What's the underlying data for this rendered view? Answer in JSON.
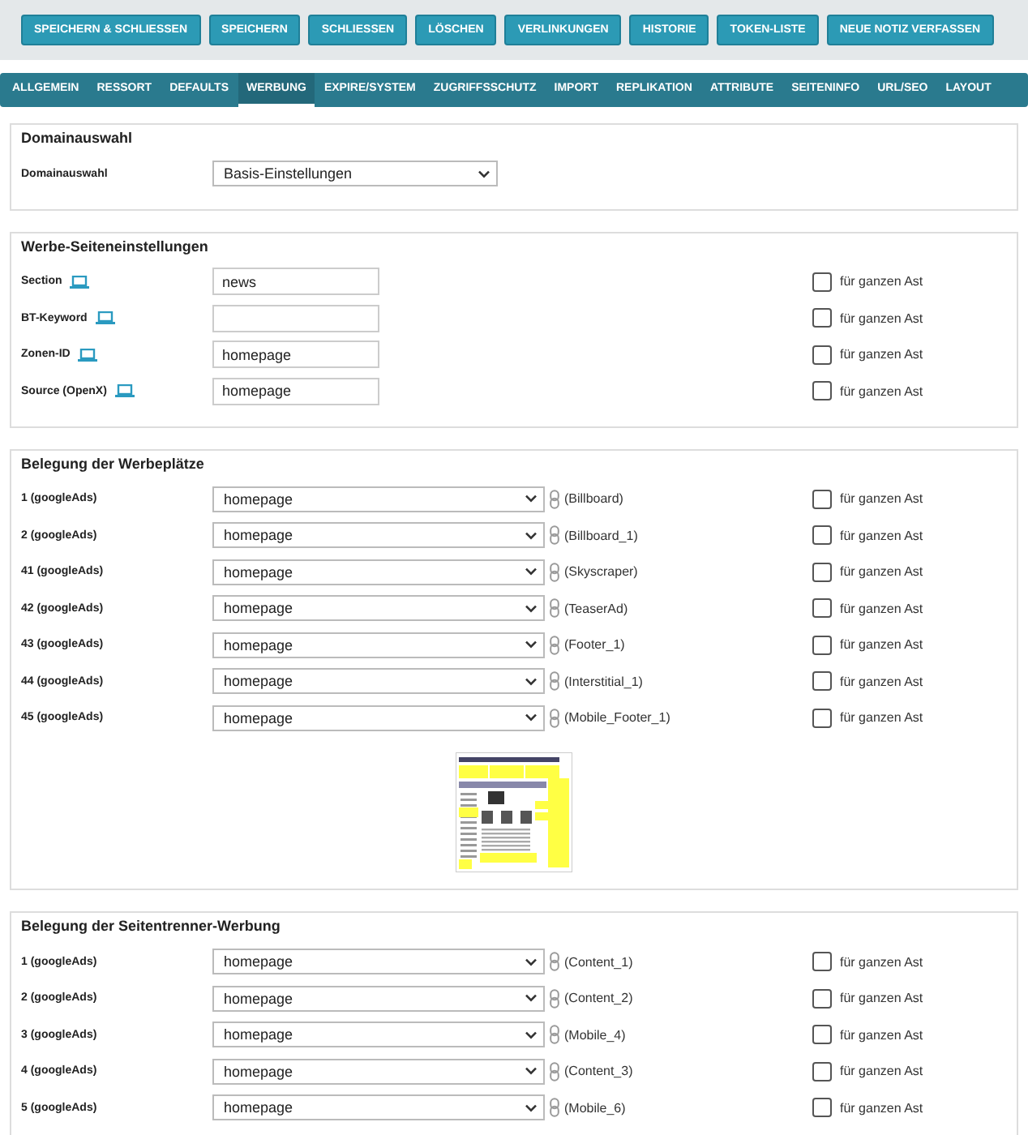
{
  "toolbar": {
    "buttons": [
      "SPEICHERN & SCHLIESSEN",
      "SPEICHERN",
      "SCHLIESSEN",
      "LÖSCHEN",
      "VERLINKUNGEN",
      "HISTORIE",
      "TOKEN-LISTE",
      "NEUE NOTIZ VERFASSEN"
    ]
  },
  "tabs": [
    {
      "label": "ALLGEMEIN",
      "selected": false
    },
    {
      "label": "RESSORT",
      "selected": false
    },
    {
      "label": "DEFAULTS",
      "selected": false
    },
    {
      "label": "WERBUNG",
      "selected": true
    },
    {
      "label": "EXPIRE/SYSTEM",
      "selected": false
    },
    {
      "label": "ZUGRIFFSSCHUTZ",
      "selected": false
    },
    {
      "label": "IMPORT",
      "selected": false
    },
    {
      "label": "REPLIKATION",
      "selected": false
    },
    {
      "label": "ATTRIBUTE",
      "selected": false
    },
    {
      "label": "SEITENINFO",
      "selected": false
    },
    {
      "label": "URL/SEO",
      "selected": false
    },
    {
      "label": "LAYOUT",
      "selected": false
    }
  ],
  "domain": {
    "legend": "Domainauswahl",
    "label": "Domainauswahl",
    "value": "Basis-Einstellungen"
  },
  "page_settings": {
    "legend": "Werbe-Seiteneinstellungen",
    "rows": [
      {
        "label": "Section",
        "value": "news",
        "branch_label": "für ganzen Ast",
        "checked": false
      },
      {
        "label": "BT-Keyword",
        "value": "",
        "branch_label": "für ganzen Ast",
        "checked": false
      },
      {
        "label": "Zonen-ID",
        "value": "homepage",
        "branch_label": "für ganzen Ast",
        "checked": false
      },
      {
        "label": "Source (OpenX)",
        "value": "homepage",
        "branch_label": "für ganzen Ast",
        "checked": false
      }
    ]
  },
  "placements": {
    "legend": "Belegung der Werbeplätze",
    "rows": [
      {
        "label": "1 (googleAds)",
        "value": "homepage",
        "slot": "(Billboard)",
        "branch_label": "für ganzen Ast",
        "checked": false
      },
      {
        "label": "2 (googleAds)",
        "value": "homepage",
        "slot": "(Billboard_1)",
        "branch_label": "für ganzen Ast",
        "checked": false
      },
      {
        "label": "41 (googleAds)",
        "value": "homepage",
        "slot": "(Skyscraper)",
        "branch_label": "für ganzen Ast",
        "checked": false
      },
      {
        "label": "42 (googleAds)",
        "value": "homepage",
        "slot": "(TeaserAd)",
        "branch_label": "für ganzen Ast",
        "checked": false
      },
      {
        "label": "43 (googleAds)",
        "value": "homepage",
        "slot": "(Footer_1)",
        "branch_label": "für ganzen Ast",
        "checked": false
      },
      {
        "label": "44 (googleAds)",
        "value": "homepage",
        "slot": "(Interstitial_1)",
        "branch_label": "für ganzen Ast",
        "checked": false
      },
      {
        "label": "45 (googleAds)",
        "value": "homepage",
        "slot": "(Mobile_Footer_1)",
        "branch_label": "für ganzen Ast",
        "checked": false
      }
    ]
  },
  "separators": {
    "legend": "Belegung der Seitentrenner-Werbung",
    "rows": [
      {
        "label": "1 (googleAds)",
        "value": "homepage",
        "slot": "(Content_1)",
        "branch_label": "für ganzen Ast",
        "checked": false
      },
      {
        "label": "2 (googleAds)",
        "value": "homepage",
        "slot": "(Content_2)",
        "branch_label": "für ganzen Ast",
        "checked": false
      },
      {
        "label": "3 (googleAds)",
        "value": "homepage",
        "slot": "(Mobile_4)",
        "branch_label": "für ganzen Ast",
        "checked": false
      },
      {
        "label": "4 (googleAds)",
        "value": "homepage",
        "slot": "(Content_3)",
        "branch_label": "für ganzen Ast",
        "checked": false
      },
      {
        "label": "5 (googleAds)",
        "value": "homepage",
        "slot": "(Mobile_6)",
        "branch_label": "für ganzen Ast",
        "checked": false
      }
    ]
  }
}
